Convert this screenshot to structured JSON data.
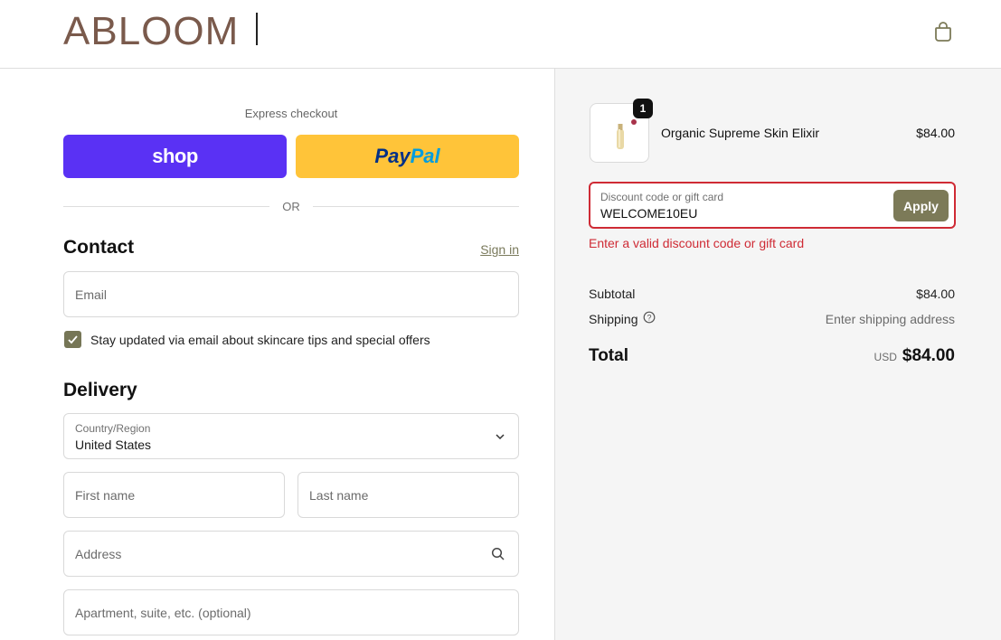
{
  "header": {
    "logo": "ABLOOM",
    "cart_icon": "shopping-bag-icon"
  },
  "express": {
    "title": "Express checkout",
    "shop_label": "shop",
    "paypal_pay": "Pay",
    "paypal_pal": "Pal",
    "or_text": "OR"
  },
  "contact": {
    "heading": "Contact",
    "signin_label": "Sign in",
    "email_placeholder": "Email",
    "newsletter_checked": true,
    "newsletter_label": "Stay updated via email about skincare tips and special offers"
  },
  "delivery": {
    "heading": "Delivery",
    "country_label": "Country/Region",
    "country_value": "United States",
    "first_name_placeholder": "First name",
    "last_name_placeholder": "Last name",
    "address_placeholder": "Address",
    "apartment_placeholder": "Apartment, suite, etc. (optional)"
  },
  "summary": {
    "product": {
      "name": "Organic Supreme Skin Elixir",
      "price": "$84.00",
      "quantity": "1"
    },
    "discount": {
      "label": "Discount code or gift card",
      "value": "WELCOME10EU",
      "apply_label": "Apply",
      "error": "Enter a valid discount code or gift card"
    },
    "subtotal_label": "Subtotal",
    "subtotal_value": "$84.00",
    "shipping_label": "Shipping",
    "shipping_value": "Enter shipping address",
    "total_label": "Total",
    "total_currency": "USD",
    "total_value": "$84.00"
  },
  "colors": {
    "brand": "#7a5a4c",
    "accent": "#767656",
    "shop": "#5a31f4",
    "paypal": "#ffc439",
    "error": "#cf2b35"
  }
}
